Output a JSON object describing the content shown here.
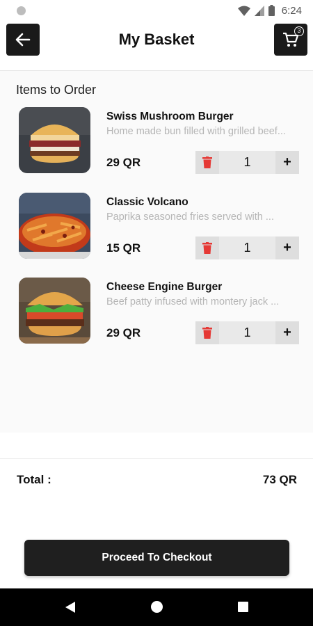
{
  "status_bar": {
    "time": "6:24"
  },
  "header": {
    "title": "My Basket",
    "cart_count": "3"
  },
  "section_title": "Items to Order",
  "items": [
    {
      "name": "Swiss Mushroom Burger",
      "description": "Home made bun filled with grilled beef...",
      "price": "29 QR",
      "quantity": "1",
      "image": "swiss-mushroom-burger-photo"
    },
    {
      "name": "Classic Volcano",
      "description": "Paprika seasoned fries served with  ...",
      "price": "15 QR",
      "quantity": "1",
      "image": "classic-volcano-fries-photo"
    },
    {
      "name": "Cheese Engine Burger",
      "description": "Beef patty infused with montery jack ...",
      "price": "29 QR",
      "quantity": "1",
      "image": "cheese-engine-burger-photo"
    }
  ],
  "total": {
    "label": "Total :",
    "value": "73 QR"
  },
  "checkout": {
    "label": "Proceed To Checkout"
  },
  "colors": {
    "dark": "#1f1f1f",
    "trash_red": "#e53935",
    "qty_bg": "#e9e9e9"
  }
}
